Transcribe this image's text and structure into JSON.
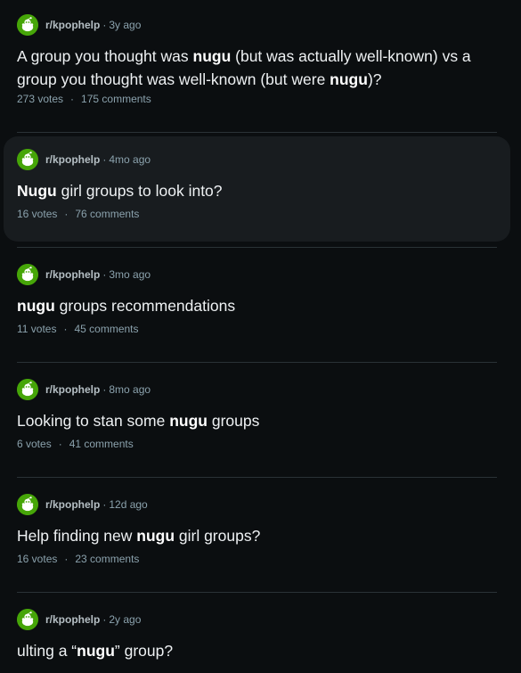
{
  "posts": [
    {
      "subreddit": "r/kpophelp",
      "age": "3y ago",
      "title_parts": [
        {
          "text": "A group you thought was ",
          "bold": false
        },
        {
          "text": "nugu",
          "bold": true
        },
        {
          "text": " (but was actually well-known) vs a group you thought was well-known (but were ",
          "bold": false
        },
        {
          "text": "nugu",
          "bold": true
        },
        {
          "text": ")?",
          "bold": false
        }
      ],
      "votes": "273 votes",
      "comments": "175 comments",
      "hovered": false
    },
    {
      "subreddit": "r/kpophelp",
      "age": "4mo ago",
      "title_parts": [
        {
          "text": "Nugu",
          "bold": true
        },
        {
          "text": " girl groups to look into?",
          "bold": false
        }
      ],
      "votes": "16 votes",
      "comments": "76 comments",
      "hovered": true
    },
    {
      "subreddit": "r/kpophelp",
      "age": "3mo ago",
      "title_parts": [
        {
          "text": "nugu",
          "bold": true
        },
        {
          "text": " groups recommendations",
          "bold": false
        }
      ],
      "votes": "11 votes",
      "comments": "45 comments",
      "hovered": false
    },
    {
      "subreddit": "r/kpophelp",
      "age": "8mo ago",
      "title_parts": [
        {
          "text": "Looking to stan some ",
          "bold": false
        },
        {
          "text": "nugu",
          "bold": true
        },
        {
          "text": " groups",
          "bold": false
        }
      ],
      "votes": "6 votes",
      "comments": "41 comments",
      "hovered": false
    },
    {
      "subreddit": "r/kpophelp",
      "age": "12d ago",
      "title_parts": [
        {
          "text": "Help finding new ",
          "bold": false
        },
        {
          "text": "nugu",
          "bold": true
        },
        {
          "text": " girl groups?",
          "bold": false
        }
      ],
      "votes": "16 votes",
      "comments": "23 comments",
      "hovered": false
    },
    {
      "subreddit": "r/kpophelp",
      "age": "2y ago",
      "title_parts": [
        {
          "text": "ulting a “",
          "bold": false
        },
        {
          "text": "nugu",
          "bold": true
        },
        {
          "text": "” group?",
          "bold": false
        }
      ],
      "votes": "",
      "comments": "",
      "hovered": false
    }
  ],
  "meta_separator": "·",
  "icon": "subreddit-snoo-icon",
  "colors": {
    "background": "#0b0e10",
    "hover_background": "#181c1f",
    "icon_green": "#46a508",
    "muted_text": "#8ba2ad"
  }
}
